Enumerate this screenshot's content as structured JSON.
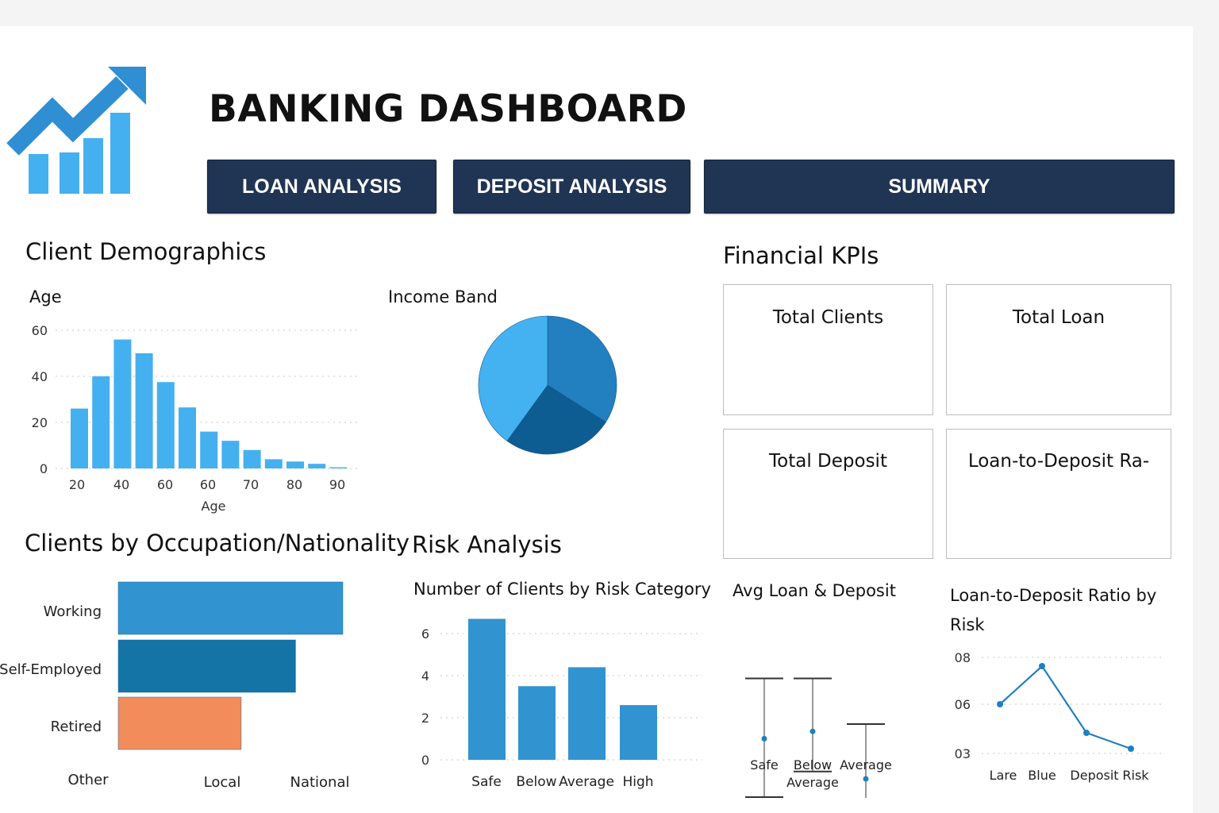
{
  "header": {
    "title": "BANKING DASHBOARD",
    "logo_icon": "trending-up-bar-chart-icon"
  },
  "nav": {
    "loan": "LOAN ANALYSIS",
    "deposit": "DEPOSIT ANALYSIS",
    "summary": "SUMMARY"
  },
  "sections": {
    "demographics": "Client Demographics",
    "kpis": "Financial KPIs",
    "occupation": "Clients by Occupation/Nationality",
    "risk": "Risk Analysis"
  },
  "kpi_cards": [
    "Total Clients",
    "Total Loan",
    "Total Deposit",
    "Loan-to-Deposit Ra-"
  ],
  "colors": {
    "nav_bg": "#203454",
    "bar_light": "#45b0ef",
    "bar_mid": "#3193cf",
    "bar_dark": "#1474a6",
    "orange": "#f28c5a",
    "pie_1": "#227fc0",
    "pie_2": "#0d5c92",
    "pie_3": "#44b1f0"
  },
  "chart_data": [
    {
      "id": "age",
      "type": "bar",
      "title": "Age",
      "xlabel": "Age",
      "ylabel": "",
      "ylim": [
        0,
        60
      ],
      "yticks": [
        "0",
        "20",
        "40",
        "60"
      ],
      "xticks": [
        "20",
        "40",
        "60",
        "60",
        "70",
        "80",
        "90"
      ],
      "values": [
        26,
        40,
        56,
        50,
        37.5,
        26.5,
        16,
        12,
        8,
        4,
        3,
        2,
        0.5
      ]
    },
    {
      "id": "income",
      "type": "pie",
      "title": "Income Band",
      "values": [
        34,
        26,
        40
      ]
    },
    {
      "id": "occupation",
      "type": "bar",
      "orientation": "horizontal",
      "categories": [
        "Working",
        "Self-Employed",
        "Retired"
      ],
      "values": [
        95,
        75,
        52
      ],
      "axis_labels": [
        "Other",
        "Local",
        "National"
      ]
    },
    {
      "id": "risk",
      "type": "bar",
      "title": "Number of Clients by Risk Category",
      "categories": [
        "Safe",
        "Below",
        "Average",
        "High"
      ],
      "values": [
        6.7,
        3.5,
        4.4,
        2.6
      ],
      "ylim": [
        0,
        7
      ],
      "yticks": [
        "0",
        "2",
        "4",
        "6"
      ]
    },
    {
      "id": "avg_loan_deposit",
      "type": "errorbar",
      "title": "Avg Loan & Deposit",
      "categories": [
        "Safe",
        "Below\nAverage",
        "Average"
      ],
      "series": [
        {
          "mean": 5.2,
          "low": 2.0,
          "high": 8.5
        },
        {
          "mean": 5.6,
          "low": 3.4,
          "high": 8.5
        },
        {
          "mean": 3.0,
          "low": 1.9,
          "high": 6.0
        }
      ]
    },
    {
      "id": "ltd_ratio",
      "type": "line",
      "title": "Loan-to-Deposit Ratio by Risk",
      "categories": [
        "Lare",
        "Blue",
        "Deposit",
        "Risk"
      ],
      "values": [
        0.6,
        0.72,
        0.51,
        0.46
      ],
      "yticks": [
        "03",
        "06",
        "08"
      ]
    }
  ]
}
